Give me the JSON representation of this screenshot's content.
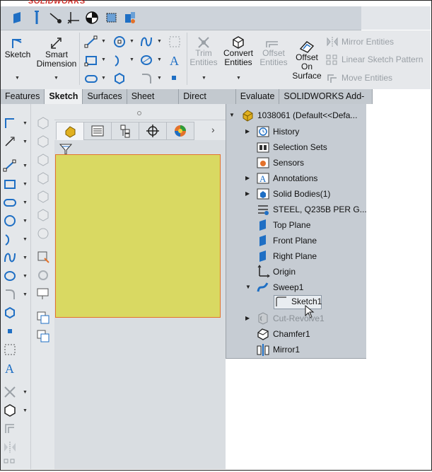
{
  "app": {
    "brand": "SOLIDWORKS"
  },
  "ribbon": {
    "sketch": "Sketch",
    "smart_dimension": [
      "Smart",
      "Dimension"
    ],
    "trim_entities": [
      "Trim",
      "Entities"
    ],
    "convert_entities": [
      "Convert",
      "Entities"
    ],
    "offset_entities": [
      "Offset",
      "Entities"
    ],
    "offset_on_surface": [
      "Offset",
      "On",
      "Surface"
    ],
    "mirror_entities": "Mirror Entities",
    "linear_sketch_pattern": "Linear Sketch Pattern",
    "move_entities": "Move Entities"
  },
  "tabs": [
    "Features",
    "Sketch",
    "Surfaces",
    "Sheet Metal",
    "Direct Editing",
    "Evaluate",
    "SOLIDWORKS Add-Ins"
  ],
  "active_tab": "Sketch",
  "tree": {
    "root": "1038061  (Default<<Defa...",
    "items": [
      {
        "label": "History"
      },
      {
        "label": "Selection Sets"
      },
      {
        "label": "Sensors"
      },
      {
        "label": "Annotations"
      },
      {
        "label": "Solid Bodies(1)"
      },
      {
        "label": "STEEL, Q235B PER G..."
      },
      {
        "label": "Top Plane"
      },
      {
        "label": "Front Plane"
      },
      {
        "label": "Right Plane"
      },
      {
        "label": "Origin"
      },
      {
        "label": "Sweep1"
      },
      {
        "label": "Sketch1"
      },
      {
        "label": "Cut-Revolve1"
      },
      {
        "label": "Chamfer1"
      },
      {
        "label": "Mirror1"
      }
    ]
  },
  "colors": {
    "accent_blue": "#1f6fc4",
    "sketch_area": "#d9d962",
    "sketch_border": "#e3722b",
    "brand_red": "#d0302a"
  }
}
